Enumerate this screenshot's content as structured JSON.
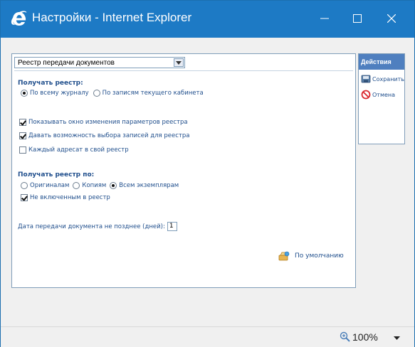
{
  "window": {
    "title": "Настройки - Internet Explorer",
    "accent_color": "#1d7ac5",
    "controls": [
      "minimize-icon",
      "maximize-icon",
      "close-icon"
    ]
  },
  "main": {
    "registry_select": {
      "value": "Реестр передачи документов"
    },
    "receive_registry": {
      "heading": "Получать реестр:",
      "options": [
        {
          "label": "По всему журналу",
          "selected": true
        },
        {
          "label": "По записям текущего кабинета",
          "selected": false
        }
      ]
    },
    "checkboxes": [
      {
        "label": "Показывать окно изменения параметров реестра",
        "checked": true
      },
      {
        "label": "Давать возможность выбора записей для реестра",
        "checked": true
      },
      {
        "label": "Каждый адресат в свой реестр",
        "checked": false
      }
    ],
    "receive_by": {
      "heading": "Получать реестр по:",
      "options": [
        {
          "label": "Оригиналам",
          "selected": false
        },
        {
          "label": "Копиям",
          "selected": false
        },
        {
          "label": "Всем экземплярам",
          "selected": true
        }
      ],
      "not_included": {
        "label": "Не включенным в реестр",
        "checked": true
      }
    },
    "days_field": {
      "label": "Дата передачи документа не позднее (дней):",
      "value": "1"
    },
    "default_link": "По умолчанию"
  },
  "actions": {
    "title": "Действия",
    "save": "Сохранить",
    "cancel": "Отмена"
  },
  "status": {
    "zoom": "100%"
  }
}
